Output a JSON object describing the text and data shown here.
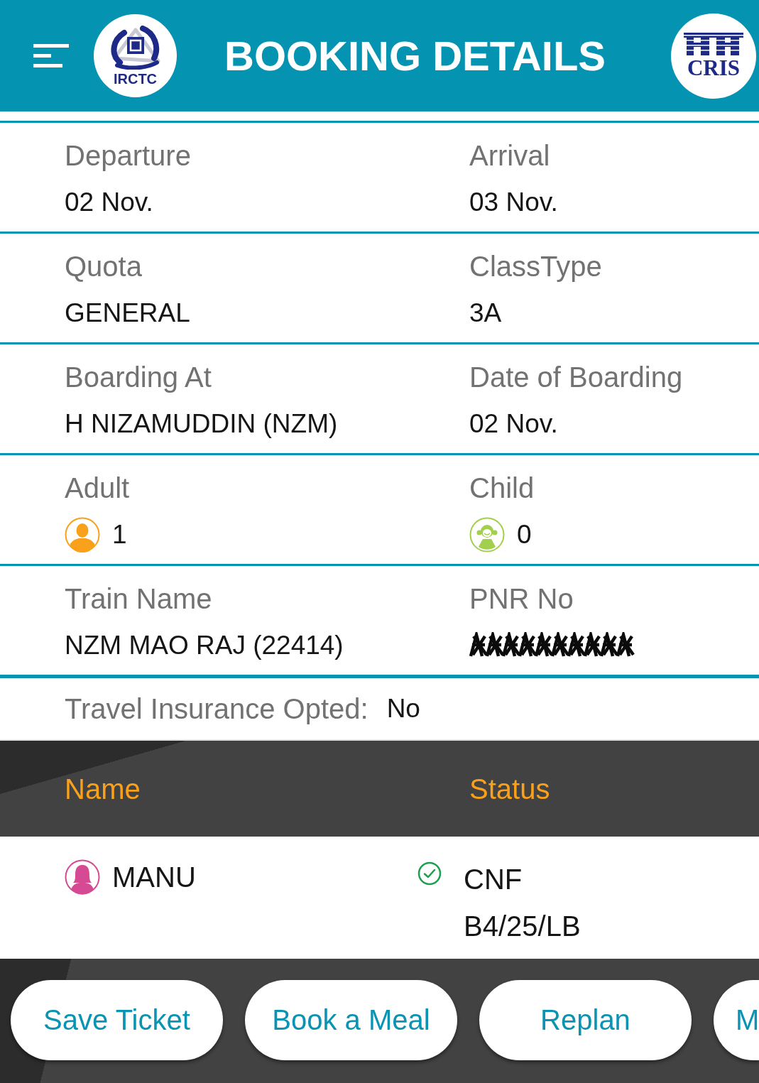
{
  "header": {
    "title": "BOOKING DETAILS",
    "left_logo_text": "IRCTC",
    "right_logo_text": "CRIS"
  },
  "details": [
    {
      "cells": [
        {
          "kind": "text",
          "label": "Departure",
          "value": "02 Nov."
        },
        {
          "kind": "text",
          "label": "Arrival",
          "value": "03 Nov."
        }
      ]
    },
    {
      "cells": [
        {
          "kind": "text",
          "label": "Quota",
          "value": "GENERAL"
        },
        {
          "kind": "text",
          "label": "ClassType",
          "value": "3A"
        }
      ]
    },
    {
      "cells": [
        {
          "kind": "text",
          "label": "Boarding At",
          "value": "H NIZAMUDDIN (NZM)"
        },
        {
          "kind": "text",
          "label": "Date of Boarding",
          "value": "02 Nov."
        }
      ]
    },
    {
      "cells": [
        {
          "kind": "adult",
          "label": "Adult",
          "value": "1"
        },
        {
          "kind": "child",
          "label": "Child",
          "value": "0"
        }
      ]
    },
    {
      "cells": [
        {
          "kind": "text",
          "label": "Train Name",
          "value": "NZM MAO RAJ (22414)"
        },
        {
          "kind": "obscured",
          "label": "PNR No"
        }
      ]
    }
  ],
  "insurance": {
    "label": "Travel Insurance Opted:",
    "value": "No"
  },
  "passengers": {
    "columns": [
      "Name",
      "Status"
    ],
    "rows": [
      {
        "name": "MANU",
        "status": "CNF",
        "berth": "B4/25/LB",
        "confirmed": true
      }
    ]
  },
  "actions": [
    {
      "label": "Save Ticket"
    },
    {
      "label": "Book a Meal"
    },
    {
      "label": "Replan"
    },
    {
      "label": "M"
    }
  ]
}
